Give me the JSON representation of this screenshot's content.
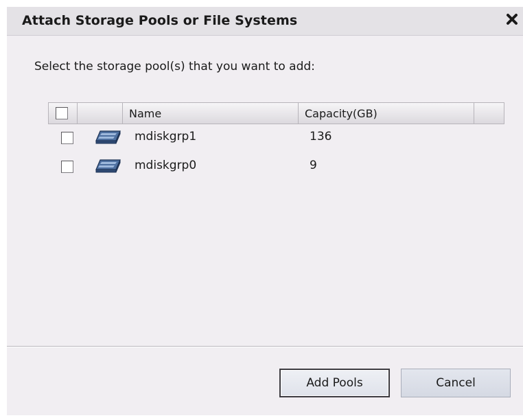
{
  "dialog": {
    "title": "Attach Storage Pools or File Systems",
    "close_icon": "close-icon"
  },
  "instruction": "Select the storage pool(s) that you want to add:",
  "table": {
    "columns": [
      "",
      "",
      "Name",
      "Capacity(GB)",
      ""
    ],
    "select_all_checked": false,
    "rows": [
      {
        "name": "mdiskgrp1",
        "capacity": "136",
        "checked": false,
        "icon": "storage-pool-icon"
      },
      {
        "name": "mdiskgrp0",
        "capacity": "9",
        "checked": false,
        "icon": "storage-pool-icon"
      }
    ]
  },
  "buttons": {
    "primary_label": "Add Pools",
    "cancel_label": "Cancel"
  }
}
